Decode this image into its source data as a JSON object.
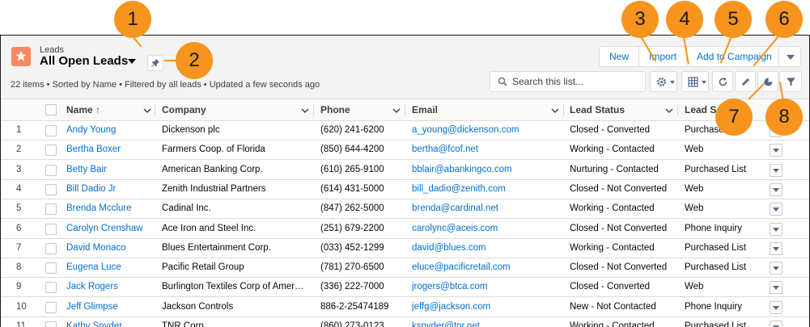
{
  "header": {
    "object_label": "Leads",
    "view_name": "All Open Leads",
    "summary": "22 items • Sorted by Name • Filtered by all leads • Updated a few seconds ago",
    "actions": [
      "New",
      "Import",
      "Add to Campaign"
    ],
    "search_placeholder": "Search this list...",
    "icon_color": "#f88962"
  },
  "toolbar_icons": [
    "gear-icon",
    "table-icon",
    "refresh-icon",
    "pencil-icon",
    "pie-chart-icon",
    "filter-icon"
  ],
  "callouts": [
    "1",
    "2",
    "3",
    "4",
    "5",
    "6",
    "7",
    "8"
  ],
  "table": {
    "columns": [
      "Name",
      "Company",
      "Phone",
      "Email",
      "Lead Status",
      "Lead So"
    ],
    "sort_indicator": "↑",
    "rows": [
      {
        "num": "1",
        "name": "Andy Young",
        "company": "Dickenson plc",
        "phone": "(620) 241-6200",
        "email": "a_young@dickenson.com",
        "status": "Closed - Converted",
        "source": "Purchase"
      },
      {
        "num": "2",
        "name": "Bertha Boxer",
        "company": "Farmers Coop. of Florida",
        "phone": "(850) 644-4200",
        "email": "bertha@fcof.net",
        "status": "Working - Contacted",
        "source": "Web"
      },
      {
        "num": "3",
        "name": "Betty Bair",
        "company": "American Banking Corp.",
        "phone": "(610) 265-9100",
        "email": "bblair@abankingco.com",
        "status": "Nurturing - Contacted",
        "source": "Purchased List"
      },
      {
        "num": "4",
        "name": "Bill Dadio Jr",
        "company": "Zenith Industrial Partners",
        "phone": "(614) 431-5000",
        "email": "bill_dadio@zenith.com",
        "status": "Closed - Not Converted",
        "source": "Web"
      },
      {
        "num": "5",
        "name": "Brenda Mcclure",
        "company": "Cadinal Inc.",
        "phone": "(847) 262-5000",
        "email": "brenda@cardinal.net",
        "status": "Working - Contacted",
        "source": "Web"
      },
      {
        "num": "6",
        "name": "Carolyn Crenshaw",
        "company": "Ace Iron and Steel Inc.",
        "phone": "(251) 679-2200",
        "email": "carolync@aceis.com",
        "status": "Closed - Not Converted",
        "source": "Phone Inquiry"
      },
      {
        "num": "7",
        "name": "David Monaco",
        "company": "Blues Entertainment Corp.",
        "phone": "(033) 452-1299",
        "email": "david@blues.com",
        "status": "Working - Contacted",
        "source": "Purchased List"
      },
      {
        "num": "8",
        "name": "Eugena Luce",
        "company": "Pacific Retail Group",
        "phone": "(781) 270-6500",
        "email": "eluce@pacificretail.com",
        "status": "Closed - Not Converted",
        "source": "Purchased List"
      },
      {
        "num": "9",
        "name": "Jack Rogers",
        "company": "Burlington Textiles Corp of Amer…",
        "phone": "(336) 222-7000",
        "email": "jrogers@btca.com",
        "status": "Closed - Converted",
        "source": "Web"
      },
      {
        "num": "10",
        "name": "Jeff Glimpse",
        "company": "Jackson Controls",
        "phone": "886-2-25474189",
        "email": "jeffg@jackson.com",
        "status": "New - Not Contacted",
        "source": "Phone Inquiry"
      },
      {
        "num": "11",
        "name": "Kathy Snyder",
        "company": "TNR Corp.",
        "phone": "(860) 273-0123",
        "email": "ksnyder@tnr.net",
        "status": "Working - Contacted",
        "source": "Purchased List"
      }
    ]
  }
}
